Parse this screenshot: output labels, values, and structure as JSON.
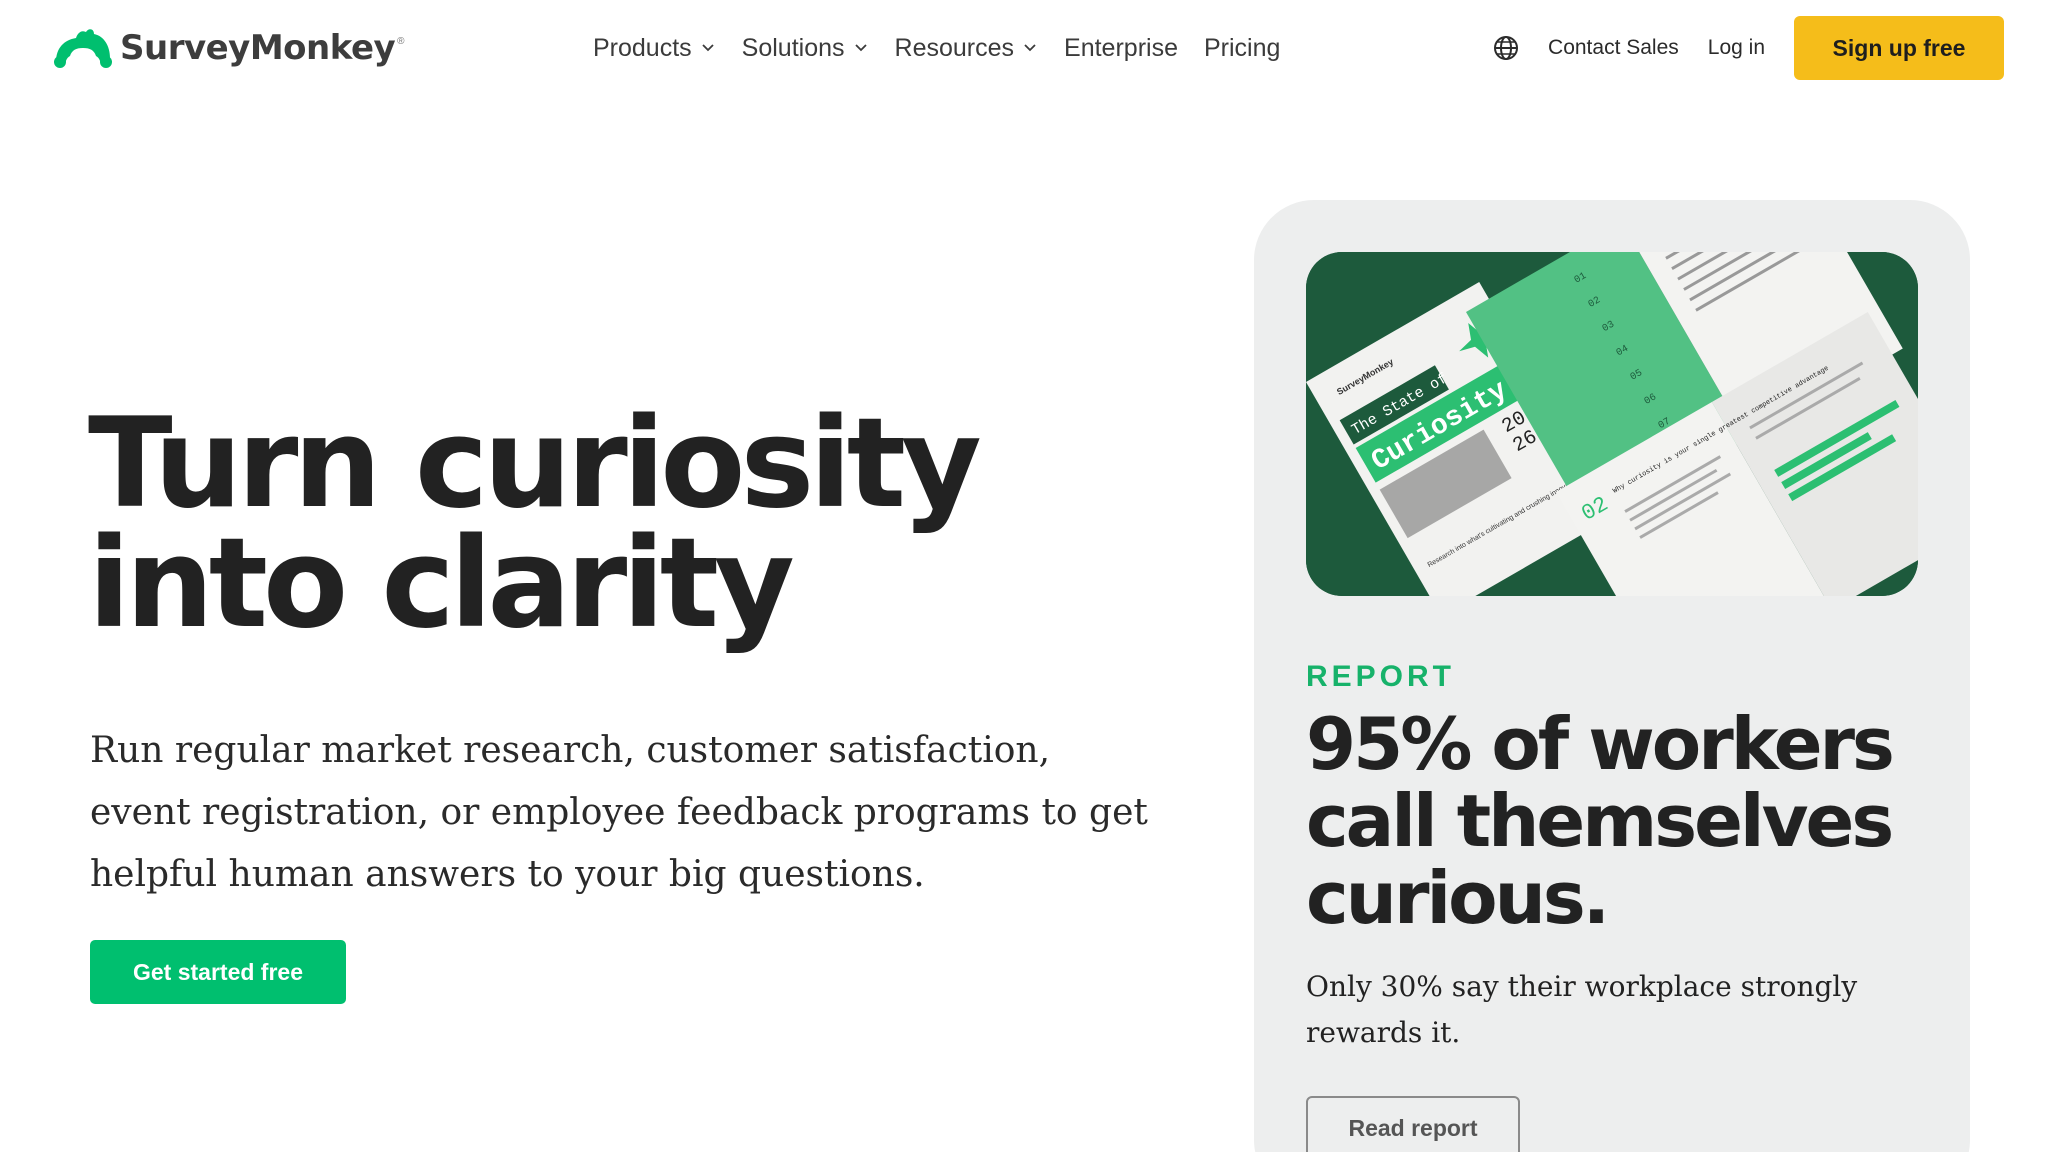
{
  "brand": {
    "name": "SurveyMonkey",
    "trademark": "®",
    "logo_color": "#00bf6f"
  },
  "nav": {
    "items": [
      {
        "label": "Products",
        "has_dropdown": true
      },
      {
        "label": "Solutions",
        "has_dropdown": true
      },
      {
        "label": "Resources",
        "has_dropdown": true
      },
      {
        "label": "Enterprise",
        "has_dropdown": false
      },
      {
        "label": "Pricing",
        "has_dropdown": false
      }
    ]
  },
  "header_right": {
    "globe_icon": "globe-icon",
    "contact_sales": "Contact Sales",
    "log_in": "Log in",
    "sign_up": "Sign up free",
    "sign_up_color": "#f5bd1a"
  },
  "hero": {
    "title": "Turn curiosity into clarity",
    "description": "Run regular market research, customer satisfaction, event registration, or employee feedback programs to get helpful human answers to your big questions.",
    "cta_label": "Get started free",
    "cta_color": "#00bf6f"
  },
  "promo": {
    "tag": "REPORT",
    "title": "95% of workers call themselves curious.",
    "description": "Only 30% say their workplace strongly rewards it.",
    "button_label": "Read report",
    "image": {
      "brand": "SurveyMonkey",
      "cover_title_prefix": "The State of",
      "cover_title_main": "Curiosity",
      "cover_year_top": "20",
      "cover_year_bottom": "26",
      "cover_subtitle": "Research into what's cultivating and crushing innovation in workplaces today",
      "toc_numbers": [
        "01",
        "02",
        "03",
        "04",
        "05",
        "06",
        "07"
      ],
      "chapter_number": "02",
      "chapter_title": "Why curiosity is your single greatest competitive advantage"
    },
    "tag_color": "#17b26a"
  }
}
